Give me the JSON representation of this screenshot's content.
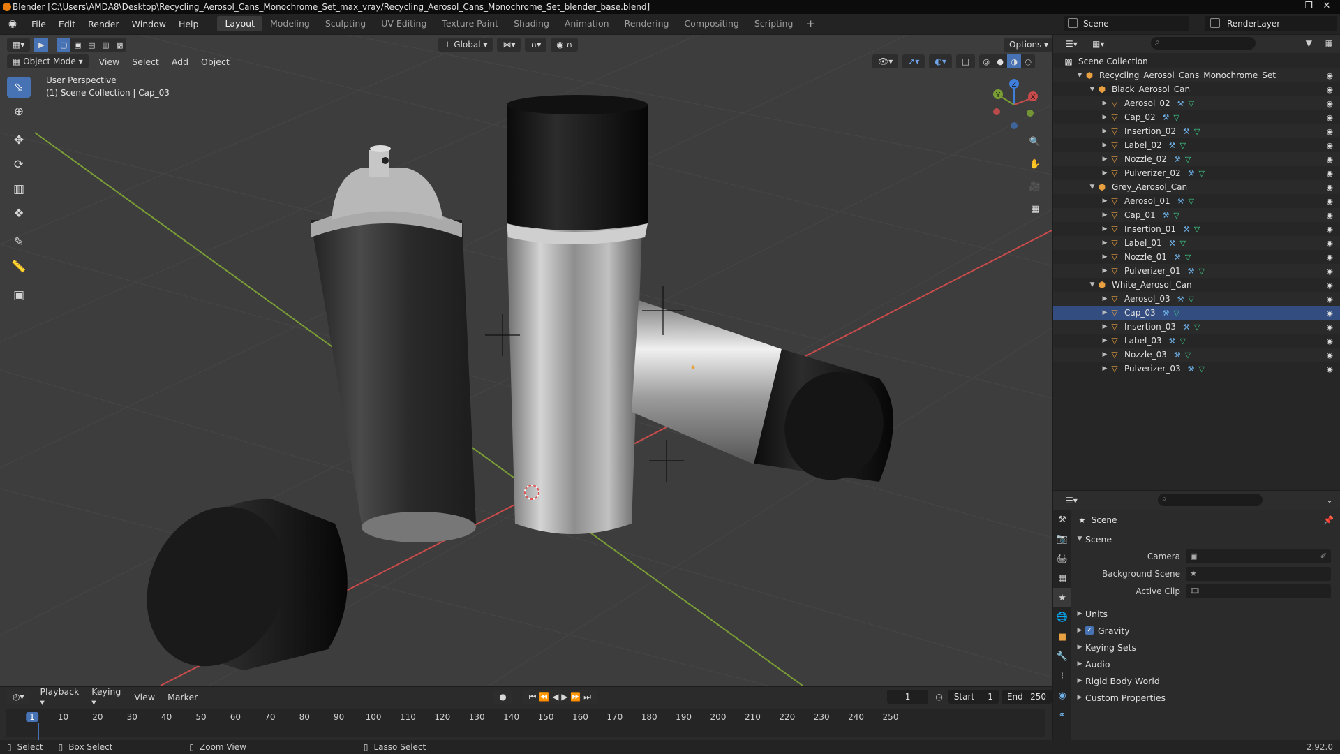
{
  "window": {
    "title": "Blender [C:\\Users\\AMDA8\\Desktop\\Recycling_Aerosol_Cans_Monochrome_Set_max_vray/Recycling_Aerosol_Cans_Monochrome_Set_blender_base.blend]",
    "controls": [
      "–",
      "❐",
      "✕"
    ]
  },
  "menubar": {
    "items": [
      "File",
      "Edit",
      "Render",
      "Window",
      "Help"
    ],
    "tabs": [
      "Layout",
      "Modeling",
      "Sculpting",
      "UV Editing",
      "Texture Paint",
      "Shading",
      "Animation",
      "Rendering",
      "Compositing",
      "Scripting"
    ],
    "active_tab": "Layout",
    "add_tab": "+",
    "scene_name": "Scene",
    "view_layer": "RenderLayer"
  },
  "viewport": {
    "mode": "Object Mode",
    "menus": [
      "View",
      "Select",
      "Add",
      "Object"
    ],
    "transform_orientation": "Global",
    "options_label": "Options",
    "info_line1": "User Perspective",
    "info_line2": "(1) Scene Collection | Cap_03",
    "tools": [
      "select-box-icon",
      "cursor-icon",
      "move-icon",
      "rotate-icon",
      "scale-icon",
      "transform-icon",
      "annotate-icon",
      "measure-icon",
      "add-cube-icon"
    ],
    "gizmo_axes": [
      "X",
      "Y",
      "Z"
    ],
    "colors": {
      "x_axis": "#c94b4b",
      "y_axis": "#7a9e35",
      "z_axis": "#3f7fd9",
      "accent": "#4772b3"
    }
  },
  "outliner": {
    "root": "Scene Collection",
    "rows": [
      {
        "label": "Recycling_Aerosol_Cans_Monochrome_Set",
        "level": 1,
        "type": "collection"
      },
      {
        "label": "Black_Aerosol_Can",
        "level": 2,
        "type": "collection"
      },
      {
        "label": "Aerosol_02",
        "level": 3,
        "type": "object"
      },
      {
        "label": "Cap_02",
        "level": 3,
        "type": "object"
      },
      {
        "label": "Insertion_02",
        "level": 3,
        "type": "object"
      },
      {
        "label": "Label_02",
        "level": 3,
        "type": "object"
      },
      {
        "label": "Nozzle_02",
        "level": 3,
        "type": "object"
      },
      {
        "label": "Pulverizer_02",
        "level": 3,
        "type": "object"
      },
      {
        "label": "Grey_Aerosol_Can",
        "level": 2,
        "type": "collection"
      },
      {
        "label": "Aerosol_01",
        "level": 3,
        "type": "object"
      },
      {
        "label": "Cap_01",
        "level": 3,
        "type": "object"
      },
      {
        "label": "Insertion_01",
        "level": 3,
        "type": "object"
      },
      {
        "label": "Label_01",
        "level": 3,
        "type": "object"
      },
      {
        "label": "Nozzle_01",
        "level": 3,
        "type": "object"
      },
      {
        "label": "Pulverizer_01",
        "level": 3,
        "type": "object"
      },
      {
        "label": "White_Aerosol_Can",
        "level": 2,
        "type": "collection"
      },
      {
        "label": "Aerosol_03",
        "level": 3,
        "type": "object"
      },
      {
        "label": "Cap_03",
        "level": 3,
        "type": "object",
        "selected": true
      },
      {
        "label": "Insertion_03",
        "level": 3,
        "type": "object"
      },
      {
        "label": "Label_03",
        "level": 3,
        "type": "object"
      },
      {
        "label": "Nozzle_03",
        "level": 3,
        "type": "object"
      },
      {
        "label": "Pulverizer_03",
        "level": 3,
        "type": "object"
      }
    ]
  },
  "properties": {
    "context": "Scene",
    "panel": "Scene",
    "fields": [
      {
        "label": "Camera"
      },
      {
        "label": "Background Scene"
      },
      {
        "label": "Active Clip"
      }
    ],
    "subpanels": [
      "Units",
      "Gravity",
      "Keying Sets",
      "Audio",
      "Rigid Body World",
      "Custom Properties"
    ],
    "gravity_checked": true
  },
  "timeline": {
    "menus": [
      "Playback",
      "Keying",
      "View",
      "Marker"
    ],
    "current_frame": "1",
    "start_label": "Start",
    "start": "1",
    "end_label": "End",
    "end": "250",
    "ticks": [
      "1",
      "10",
      "20",
      "30",
      "40",
      "50",
      "60",
      "70",
      "80",
      "90",
      "100",
      "110",
      "120",
      "130",
      "140",
      "150",
      "160",
      "170",
      "180",
      "190",
      "200",
      "210",
      "220",
      "230",
      "240",
      "250"
    ]
  },
  "statusbar": {
    "select": "Select",
    "box_select": "Box Select",
    "zoom_view": "Zoom View",
    "lasso_select": "Lasso Select",
    "version": "2.92.0"
  }
}
